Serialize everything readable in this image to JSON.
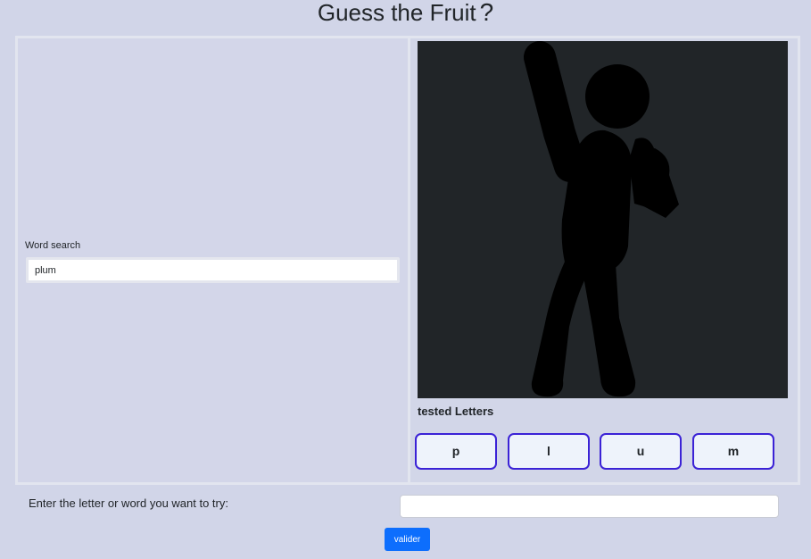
{
  "page": {
    "title": "Guess the Fruit",
    "title_mark": "?"
  },
  "word_search": {
    "label": "Word search",
    "value": "plum"
  },
  "hangman": {
    "figure_icon": "stick-figure-hangman",
    "background": "#212528",
    "figure_color": "#000000"
  },
  "tested_letters": {
    "label": "tested Letters",
    "letters": [
      "p",
      "l",
      "u",
      "m"
    ]
  },
  "guess_form": {
    "label": "Enter the letter or word you want to try:",
    "input_value": "",
    "submit_label": "valider"
  },
  "colors": {
    "page_background": "#d1d5e8",
    "tile_border": "#3b22d6",
    "tile_background": "#eef3fb",
    "submit_background": "#0d6efd"
  }
}
